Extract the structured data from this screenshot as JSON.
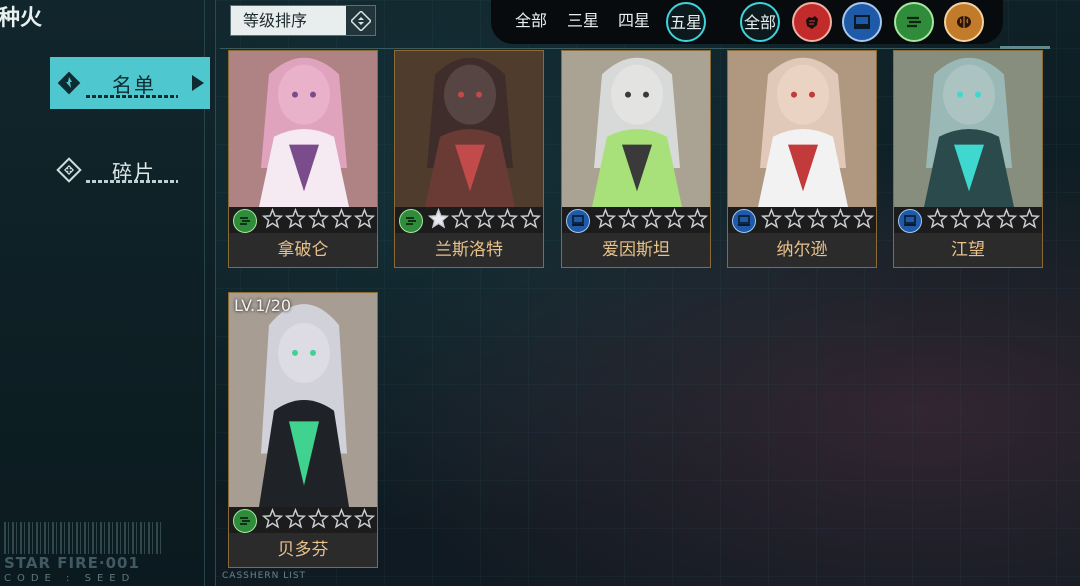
{
  "page_title": "种火",
  "nav": {
    "roster_label": "名单",
    "fragments_label": "碎片"
  },
  "sort": {
    "label": "等级排序"
  },
  "filters": {
    "rarity": [
      "全部",
      "三星",
      "四星",
      "五星"
    ],
    "rarity_selected": "五星",
    "class_all": "全部",
    "classes": [
      "fist-icon",
      "monitor-icon",
      "speed-icon",
      "brain-icon"
    ]
  },
  "footer": {
    "brand": "STAR FIRE·001",
    "code": "CODE : SEED",
    "list_caption": "CASSHERN LIST"
  },
  "cards": [
    {
      "name": "拿破仑",
      "class": "speed",
      "stars_filled": 0,
      "stars_total": 5,
      "level": "",
      "colors": [
        "#e7a9c9",
        "#f5e9f2",
        "#7a4c8c"
      ]
    },
    {
      "name": "兰斯洛特",
      "class": "speed",
      "stars_filled": 1,
      "stars_total": 5,
      "level": "",
      "colors": [
        "#3b2a2a",
        "#6a3a34",
        "#c24a4a"
      ]
    },
    {
      "name": "爱因斯坦",
      "class": "monitor",
      "stars_filled": 0,
      "stars_total": 5,
      "level": "",
      "colors": [
        "#dfe4e4",
        "#a8e07a",
        "#3a3a3a"
      ]
    },
    {
      "name": "纳尔逊",
      "class": "monitor",
      "stars_filled": 0,
      "stars_total": 5,
      "level": "",
      "colors": [
        "#e9d1c2",
        "#f2f2f2",
        "#c23a3a"
      ]
    },
    {
      "name": "江望",
      "class": "monitor",
      "stars_filled": 0,
      "stars_total": 5,
      "level": "",
      "colors": [
        "#9ec0c0",
        "#2a4a4c",
        "#3fd8cf"
      ]
    },
    {
      "name": "贝多芬",
      "class": "speed",
      "stars_filled": 0,
      "stars_total": 5,
      "level": "LV.1/20",
      "colors": [
        "#d8dbe6",
        "#1f2328",
        "#3fd38f"
      ]
    }
  ]
}
